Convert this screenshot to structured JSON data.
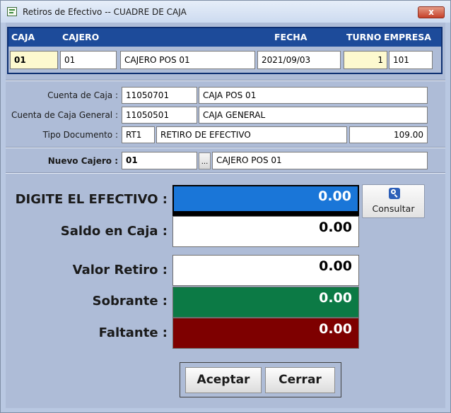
{
  "window": {
    "title": "Retiros de Efectivo  --  CUADRE DE CAJA",
    "close_label": "x"
  },
  "header": {
    "columns": {
      "caja": "CAJA",
      "cajero": "CAJERO",
      "fecha": "FECHA",
      "turno": "TURNO",
      "empresa": "EMPRESA"
    },
    "values": {
      "caja": "01",
      "cajero_code": "01",
      "cajero_name": "CAJERO POS 01",
      "fecha": "2021/09/03",
      "turno": "1",
      "empresa": "101"
    }
  },
  "accounts": {
    "cuenta_caja": {
      "label": "Cuenta de Caja :",
      "code": "11050701",
      "name": "CAJA POS 01"
    },
    "cuenta_general": {
      "label": "Cuenta de Caja General :",
      "code": "11050501",
      "name": "CAJA GENERAL"
    },
    "tipo_documento": {
      "label": "Tipo Documento :",
      "code": "RT1",
      "name": "RETIRO DE EFECTIVO",
      "value": "109.00"
    }
  },
  "nuevo_cajero": {
    "label": "Nuevo Cajero :",
    "code": "01",
    "lookup_label": "...",
    "name": "CAJERO POS 01"
  },
  "amounts": {
    "digite": {
      "label": "DIGITE EL EFECTIVO :",
      "value": "0.00"
    },
    "saldo": {
      "label": "Saldo en Caja :",
      "value": "0.00"
    },
    "retiro": {
      "label": "Valor Retiro :",
      "value": "0.00"
    },
    "sobrante": {
      "label": "Sobrante :",
      "value": "0.00"
    },
    "faltante": {
      "label": "Faltante :",
      "value": "0.00"
    }
  },
  "buttons": {
    "consultar": "Consultar",
    "aceptar": "Aceptar",
    "cerrar": "Cerrar"
  },
  "colors": {
    "header_bar": "#1d4b9a",
    "focus_field": "#1a76d8",
    "sobrante": "#0c7a45",
    "faltante": "#7e0000"
  },
  "icons": [
    "app-window-icon",
    "magnifier-icon",
    "close-icon"
  ]
}
